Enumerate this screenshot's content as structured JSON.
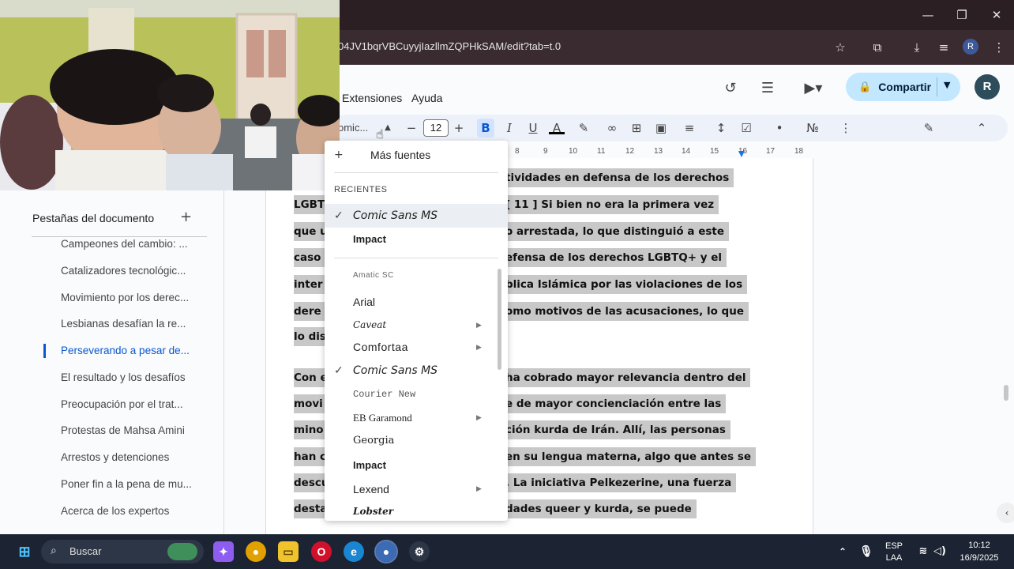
{
  "browser": {
    "url": "04JV1bqrVBCuyyjIazllmZQPHkSAM/edit?tab=t.0",
    "profile_initial": "R"
  },
  "docs_header": {
    "menu": [
      "Extensiones",
      "Ayuda"
    ],
    "share_label": "Compartir",
    "avatar_initial": "R"
  },
  "toolbar": {
    "font": "omic...",
    "font_size": "12",
    "bold": "B",
    "italic": "I",
    "underline": "U",
    "text_color": "A"
  },
  "ruler": [
    "8",
    "9",
    "10",
    "11",
    "12",
    "13",
    "14",
    "15",
    "16",
    "17",
    "18"
  ],
  "outline": {
    "header": "Pestañas del documento",
    "items": [
      "Campeones del cambio: ...",
      "Catalizadores tecnológic...",
      "Movimiento por los derec...",
      "Lesbianas desafían la re...",
      "Perseverando a pesar de...",
      "El resultado y los desafíos",
      "Preocupación por el trat...",
      "Protestas de Mahsa Amini",
      "Arrestos y detenciones",
      "Poner fin a la pena de mu...",
      "Acerca de los expertos"
    ],
    "active_index": 4
  },
  "font_menu": {
    "more_fonts": "Más fuentes",
    "recent_header": "RECIENTES",
    "recent": [
      "Comic Sans MS",
      "Impact"
    ],
    "fonts": [
      "Amatic SC",
      "Arial",
      "Caveat",
      "Comfortaa",
      "Comic Sans MS",
      "Courier New",
      "EB Garamond",
      "Georgia",
      "Impact",
      "Lexend",
      "Lobster"
    ]
  },
  "document_lines": [
    "tividades en defensa de los derechos",
    "LGBT",
    "[ 11 ] Si bien no era la primera vez",
    "que u",
    "o arrestada, lo que distinguió a este",
    "caso",
    "efensa de los derechos LGBTQ+ y el",
    "inter",
    "blica Islámica por las violaciones de los",
    "dere",
    "omo motivos de las acusaciones, lo que",
    "lo dis",
    "Con e",
    "ha cobrado mayor relevancia dentro del",
    "movi",
    "e de mayor concienciación entre las",
    "mino",
    "ción kurda de Irán. Allí, las personas",
    "han c",
    "en su lengua materna, algo que antes se",
    "descu",
    ". La iniciativa Pelkezerine, una fuerza",
    "desta",
    "dades queer y kurda, se puede"
  ],
  "taskbar": {
    "search": "Buscar",
    "lang_top": "ESP",
    "lang_bottom": "LAA",
    "time": "10:12",
    "date": "16/9/2025"
  }
}
